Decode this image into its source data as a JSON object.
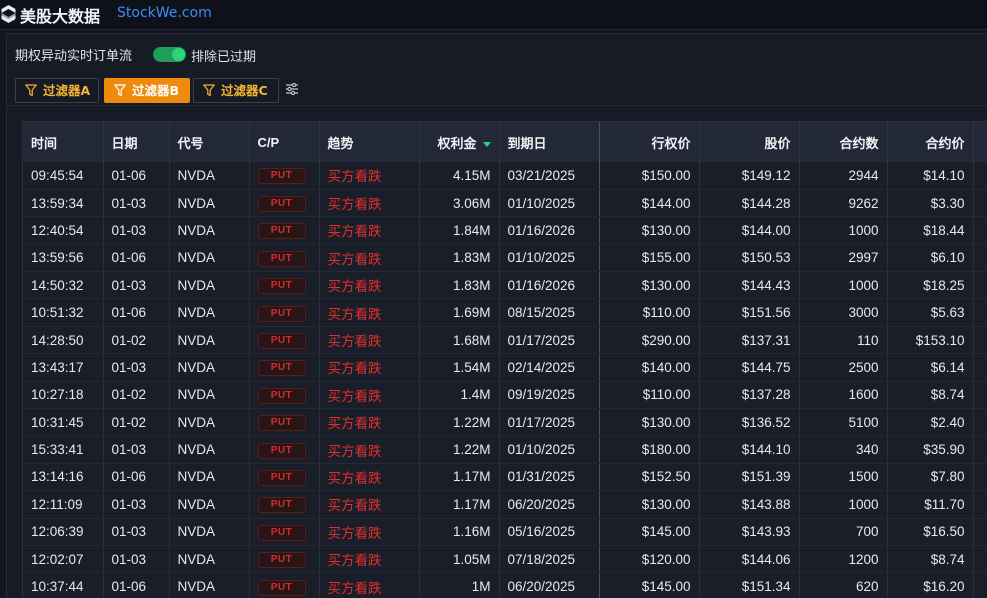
{
  "brand": {
    "name": "美股大数据",
    "site": "StockWe.com"
  },
  "header": {
    "title": "期权异动实时订单流",
    "toggle_label": "排除已过期",
    "toggle_on": true
  },
  "filters": [
    {
      "label": "过滤器A",
      "active": false
    },
    {
      "label": "过滤器B",
      "active": true
    },
    {
      "label": "过滤器C",
      "active": false
    }
  ],
  "colors": {
    "accent": "#f08a0c",
    "filter_text": "#f5b733",
    "toggle": "#2ed47a",
    "put": "#d22c2c",
    "trend": "#e02f2f"
  },
  "table": {
    "columns": [
      "时间",
      "日期",
      "代号",
      "C/P",
      "趋势",
      "权利金",
      "到期日",
      "行权价",
      "股价",
      "合约数",
      "合约价"
    ],
    "sort_column": "权利金",
    "rows": [
      [
        "09:45:54",
        "01-06",
        "NVDA",
        "PUT",
        "买方看跌",
        "4.15M",
        "03/21/2025",
        "$150.00",
        "$149.12",
        "2944",
        "$14.10"
      ],
      [
        "13:59:34",
        "01-03",
        "NVDA",
        "PUT",
        "买方看跌",
        "3.06M",
        "01/10/2025",
        "$144.00",
        "$144.28",
        "9262",
        "$3.30"
      ],
      [
        "12:40:54",
        "01-03",
        "NVDA",
        "PUT",
        "买方看跌",
        "1.84M",
        "01/16/2026",
        "$130.00",
        "$144.00",
        "1000",
        "$18.44"
      ],
      [
        "13:59:56",
        "01-06",
        "NVDA",
        "PUT",
        "买方看跌",
        "1.83M",
        "01/10/2025",
        "$155.00",
        "$150.53",
        "2997",
        "$6.10"
      ],
      [
        "14:50:32",
        "01-03",
        "NVDA",
        "PUT",
        "买方看跌",
        "1.83M",
        "01/16/2026",
        "$130.00",
        "$144.43",
        "1000",
        "$18.25"
      ],
      [
        "10:51:32",
        "01-06",
        "NVDA",
        "PUT",
        "买方看跌",
        "1.69M",
        "08/15/2025",
        "$110.00",
        "$151.56",
        "3000",
        "$5.63"
      ],
      [
        "14:28:50",
        "01-02",
        "NVDA",
        "PUT",
        "买方看跌",
        "1.68M",
        "01/17/2025",
        "$290.00",
        "$137.31",
        "110",
        "$153.10"
      ],
      [
        "13:43:17",
        "01-03",
        "NVDA",
        "PUT",
        "买方看跌",
        "1.54M",
        "02/14/2025",
        "$140.00",
        "$144.75",
        "2500",
        "$6.14"
      ],
      [
        "10:27:18",
        "01-02",
        "NVDA",
        "PUT",
        "买方看跌",
        "1.4M",
        "09/19/2025",
        "$110.00",
        "$137.28",
        "1600",
        "$8.74"
      ],
      [
        "10:31:45",
        "01-02",
        "NVDA",
        "PUT",
        "买方看跌",
        "1.22M",
        "01/17/2025",
        "$130.00",
        "$136.52",
        "5100",
        "$2.40"
      ],
      [
        "15:33:41",
        "01-03",
        "NVDA",
        "PUT",
        "买方看跌",
        "1.22M",
        "01/10/2025",
        "$180.00",
        "$144.10",
        "340",
        "$35.90"
      ],
      [
        "13:14:16",
        "01-06",
        "NVDA",
        "PUT",
        "买方看跌",
        "1.17M",
        "01/31/2025",
        "$152.50",
        "$151.39",
        "1500",
        "$7.80"
      ],
      [
        "12:11:09",
        "01-03",
        "NVDA",
        "PUT",
        "买方看跌",
        "1.17M",
        "06/20/2025",
        "$130.00",
        "$143.88",
        "1000",
        "$11.70"
      ],
      [
        "12:06:39",
        "01-03",
        "NVDA",
        "PUT",
        "买方看跌",
        "1.16M",
        "05/16/2025",
        "$145.00",
        "$143.93",
        "700",
        "$16.50"
      ],
      [
        "12:02:07",
        "01-03",
        "NVDA",
        "PUT",
        "买方看跌",
        "1.05M",
        "07/18/2025",
        "$120.00",
        "$144.06",
        "1200",
        "$8.74"
      ],
      [
        "10:37:44",
        "01-06",
        "NVDA",
        "PUT",
        "买方看跌",
        "1M",
        "06/20/2025",
        "$145.00",
        "$151.34",
        "620",
        "$16.20"
      ]
    ]
  }
}
